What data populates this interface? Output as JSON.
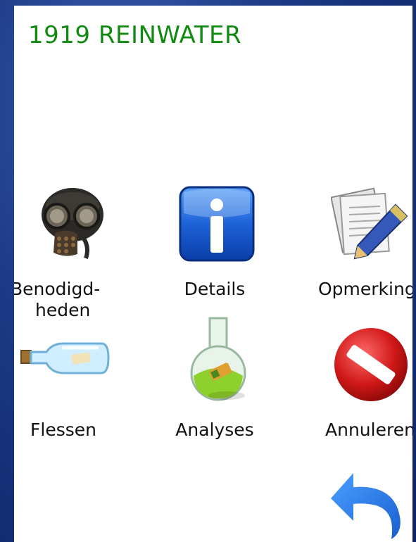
{
  "header": {
    "title": "1919 REINWATER"
  },
  "menu": {
    "items": [
      {
        "key": "benodigdheden",
        "label": "Benodigd-heden",
        "label_line1": "Benodigd-",
        "label_line2": "heden",
        "icon": "gas-mask-icon"
      },
      {
        "key": "details",
        "label": "Details",
        "icon": "info-icon"
      },
      {
        "key": "opmerkingen",
        "label": "Opmerking",
        "icon": "notes-pen-icon"
      },
      {
        "key": "flessen",
        "label": "Flessen",
        "icon": "bottle-icon"
      },
      {
        "key": "analyses",
        "label": "Analyses",
        "icon": "flask-icon"
      },
      {
        "key": "annuleren",
        "label": "Annuleren",
        "icon": "cancel-icon"
      }
    ]
  },
  "footer": {
    "back_icon": "back-arrow-icon"
  },
  "colors": {
    "title": "#118a11",
    "background": "#1d3a86",
    "panel": "#ffffff"
  }
}
